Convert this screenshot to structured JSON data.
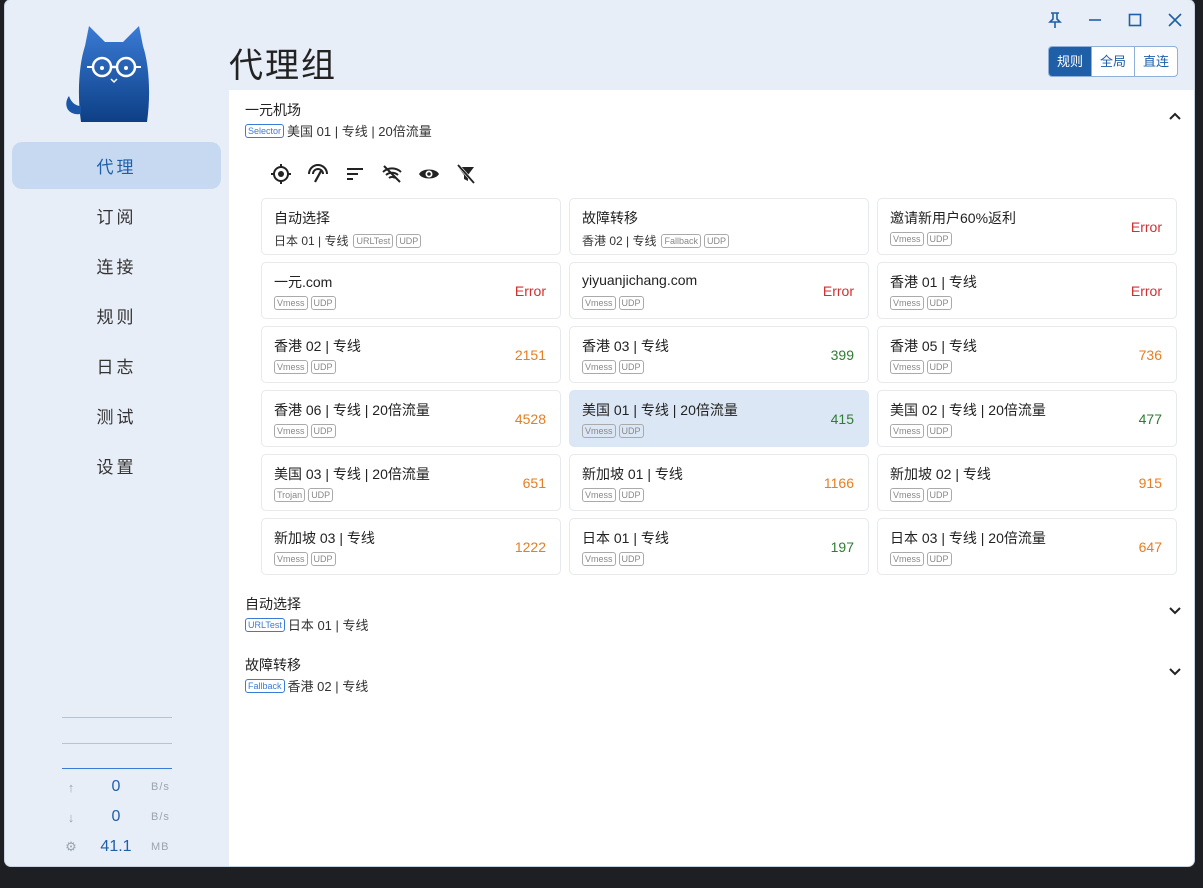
{
  "nav": {
    "items": [
      {
        "label": "代理"
      },
      {
        "label": "订阅"
      },
      {
        "label": "连接"
      },
      {
        "label": "规则"
      },
      {
        "label": "日志"
      },
      {
        "label": "测试"
      },
      {
        "label": "设置"
      }
    ],
    "active_index": 0
  },
  "traffic": {
    "upload": {
      "value": "0",
      "unit": "B/s",
      "icon": "arrow-up-icon"
    },
    "download": {
      "value": "0",
      "unit": "B/s",
      "icon": "arrow-down-icon"
    },
    "memory": {
      "value": "41.1",
      "unit": "MB",
      "icon": "memory-icon"
    }
  },
  "header": {
    "title": "代理组",
    "modes": [
      {
        "label": "规则",
        "active": true
      },
      {
        "label": "全局",
        "active": false
      },
      {
        "label": "直连",
        "active": false
      }
    ]
  },
  "groups": [
    {
      "name": "一元机场",
      "type": "Selector",
      "current": "美国 01 | 专线 | 20倍流量",
      "expanded": true,
      "chevron": "chevron-up-icon"
    },
    {
      "name": "自动选择",
      "type": "URLTest",
      "current": "日本 01 | 专线",
      "expanded": false,
      "chevron": "chevron-down-icon"
    },
    {
      "name": "故障转移",
      "type": "Fallback",
      "current": "香港 02 | 专线",
      "expanded": false,
      "chevron": "chevron-down-icon"
    }
  ],
  "toolbar": [
    "locate-icon",
    "speed-test-icon",
    "sort-icon",
    "hide-unavailable-icon",
    "visibility-icon",
    "filter-off-icon"
  ],
  "nodes": [
    {
      "name": "自动选择",
      "sub": "日本 01 | 专线",
      "tags": [
        "URLTest",
        "UDP"
      ],
      "delay": "",
      "delay_class": ""
    },
    {
      "name": "故障转移",
      "sub": "香港 02 | 专线",
      "tags": [
        "Fallback",
        "UDP"
      ],
      "delay": "",
      "delay_class": ""
    },
    {
      "name": "邀请新用户60%返利",
      "sub": "",
      "tags": [
        "Vmess",
        "UDP"
      ],
      "delay": "Error",
      "delay_class": "c-err"
    },
    {
      "name": "一元.com",
      "sub": "",
      "tags": [
        "Vmess",
        "UDP"
      ],
      "delay": "Error",
      "delay_class": "c-err"
    },
    {
      "name": "yiyuanjichang.com",
      "sub": "",
      "tags": [
        "Vmess",
        "UDP"
      ],
      "delay": "Error",
      "delay_class": "c-err"
    },
    {
      "name": "香港 01 | 专线",
      "sub": "",
      "tags": [
        "Vmess",
        "UDP"
      ],
      "delay": "Error",
      "delay_class": "c-err"
    },
    {
      "name": "香港 02 | 专线",
      "sub": "",
      "tags": [
        "Vmess",
        "UDP"
      ],
      "delay": "2151",
      "delay_class": "c-orange"
    },
    {
      "name": "香港 03 | 专线",
      "sub": "",
      "tags": [
        "Vmess",
        "UDP"
      ],
      "delay": "399",
      "delay_class": "c-green"
    },
    {
      "name": "香港 05 | 专线",
      "sub": "",
      "tags": [
        "Vmess",
        "UDP"
      ],
      "delay": "736",
      "delay_class": "c-orange"
    },
    {
      "name": "香港 06 | 专线 | 20倍流量",
      "sub": "",
      "tags": [
        "Vmess",
        "UDP"
      ],
      "delay": "4528",
      "delay_class": "c-orange"
    },
    {
      "name": "美国 01 | 专线 | 20倍流量",
      "sub": "",
      "tags": [
        "Vmess",
        "UDP"
      ],
      "delay": "415",
      "delay_class": "c-green",
      "active": true
    },
    {
      "name": "美国 02 | 专线 | 20倍流量",
      "sub": "",
      "tags": [
        "Vmess",
        "UDP"
      ],
      "delay": "477",
      "delay_class": "c-green"
    },
    {
      "name": "美国 03 | 专线 | 20倍流量",
      "sub": "",
      "tags": [
        "Trojan",
        "UDP"
      ],
      "delay": "651",
      "delay_class": "c-orange"
    },
    {
      "name": "新加坡 01 | 专线",
      "sub": "",
      "tags": [
        "Vmess",
        "UDP"
      ],
      "delay": "1166",
      "delay_class": "c-orange"
    },
    {
      "name": "新加坡 02 | 专线",
      "sub": "",
      "tags": [
        "Vmess",
        "UDP"
      ],
      "delay": "915",
      "delay_class": "c-orange"
    },
    {
      "name": "新加坡 03 | 专线",
      "sub": "",
      "tags": [
        "Vmess",
        "UDP"
      ],
      "delay": "1222",
      "delay_class": "c-orange"
    },
    {
      "name": "日本 01 | 专线",
      "sub": "",
      "tags": [
        "Vmess",
        "UDP"
      ],
      "delay": "197",
      "delay_class": "c-green"
    },
    {
      "name": "日本 03 | 专线 | 20倍流量",
      "sub": "",
      "tags": [
        "Vmess",
        "UDP"
      ],
      "delay": "647",
      "delay_class": "c-orange"
    }
  ],
  "colors": {
    "accent": "#1f5fa8",
    "error": "#d32f2f",
    "slow": "#e67e22",
    "fast": "#2e7d32"
  }
}
